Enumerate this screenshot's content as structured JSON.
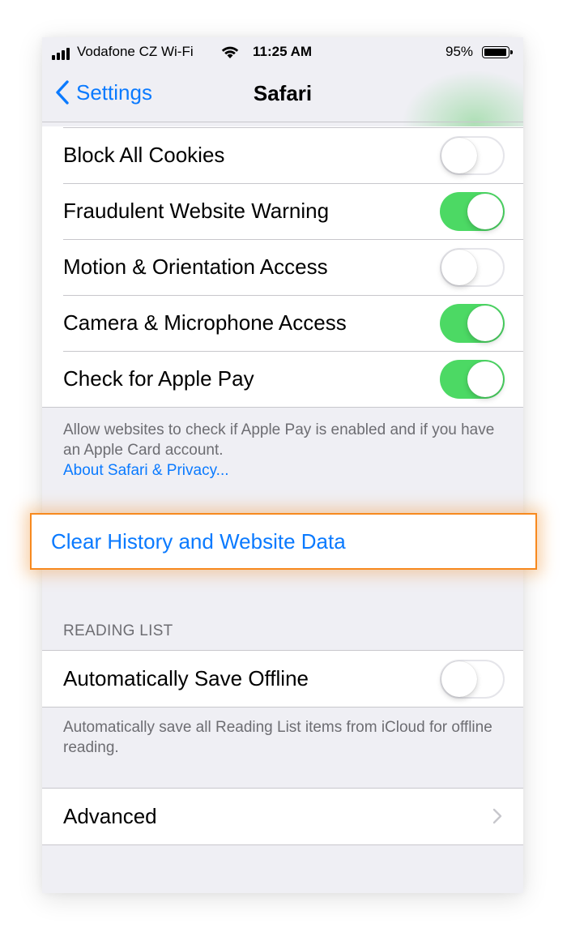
{
  "status_bar": {
    "carrier": "Vodafone CZ Wi-Fi",
    "time": "11:25 AM",
    "battery_percent": "95%",
    "battery_level": 0.95,
    "icons": [
      "signal-icon",
      "wifi-icon",
      "battery-icon"
    ]
  },
  "nav": {
    "back_label": "Settings",
    "title": "Safari"
  },
  "privacy_rows": [
    {
      "label": "Block All Cookies",
      "on": false
    },
    {
      "label": "Fraudulent Website Warning",
      "on": true
    },
    {
      "label": "Motion & Orientation Access",
      "on": false
    },
    {
      "label": "Camera & Microphone Access",
      "on": true
    },
    {
      "label": "Check for Apple Pay",
      "on": true
    }
  ],
  "privacy_footer": {
    "text": "Allow websites to check if Apple Pay is enabled and if you have an Apple Card account.",
    "link": "About Safari & Privacy..."
  },
  "clear_history": {
    "label": "Clear History and Website Data"
  },
  "reading_list": {
    "header": "READING LIST",
    "row_label": "Automatically Save Offline",
    "row_on": false,
    "footer": "Automatically save all Reading List items from iCloud for offline reading."
  },
  "advanced": {
    "label": "Advanced"
  },
  "colors": {
    "accent": "#0a7aff",
    "toggle_on": "#4cd964",
    "highlight": "#f7891e",
    "background": "#efeff4"
  }
}
